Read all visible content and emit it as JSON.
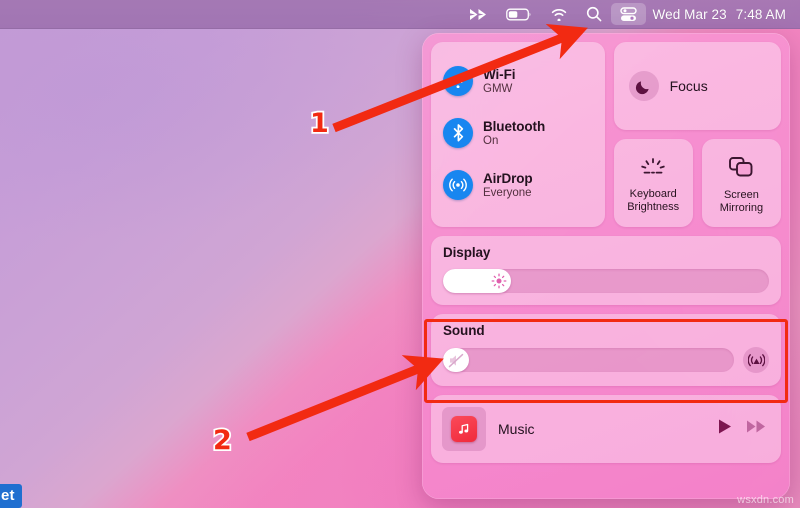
{
  "menubar": {
    "icons": [
      {
        "name": "app-chevrons-icon",
        "glyph": "chevrons"
      },
      {
        "name": "battery-icon",
        "glyph": "battery"
      },
      {
        "name": "wifi-menu-icon",
        "glyph": "wifi"
      },
      {
        "name": "spotlight-search-icon",
        "glyph": "search"
      },
      {
        "name": "control-center-icon",
        "glyph": "control-center"
      }
    ],
    "day_date": "Wed Mar 23",
    "time": "7:48 AM"
  },
  "control_center": {
    "connectivity": [
      {
        "title": "Wi-Fi",
        "subtitle": "GMW",
        "icon": "wifi-icon"
      },
      {
        "title": "Bluetooth",
        "subtitle": "On",
        "icon": "bluetooth-icon"
      },
      {
        "title": "AirDrop",
        "subtitle": "Everyone",
        "icon": "airdrop-icon"
      }
    ],
    "focus": {
      "label": "Focus",
      "icon": "moon-icon"
    },
    "tiles": [
      {
        "label": "Keyboard Brightness",
        "icon": "keyboard-brightness-icon"
      },
      {
        "label": "Screen Mirroring",
        "icon": "screen-mirroring-icon"
      }
    ],
    "display": {
      "title": "Display",
      "value_percent": 13,
      "knob_icon": "brightness-sun-icon"
    },
    "sound": {
      "title": "Sound",
      "value_percent": 0,
      "knob_icon": "speaker-mute-icon",
      "airplay_icon": "airplay-audio-icon",
      "highlighted": true
    },
    "music": {
      "label": "Music",
      "app_icon": "music-app-icon",
      "controls": [
        {
          "name": "play-button",
          "icon": "play-icon"
        },
        {
          "name": "fast-forward-button",
          "icon": "fast-forward-icon"
        }
      ]
    }
  },
  "annotations": {
    "step_one": "1",
    "step_two": "2",
    "accent_color": "#f22a12",
    "outline_color": "#ffffff"
  },
  "overlay": {
    "corner_badge": "et",
    "watermark": "wsxdn.com"
  }
}
